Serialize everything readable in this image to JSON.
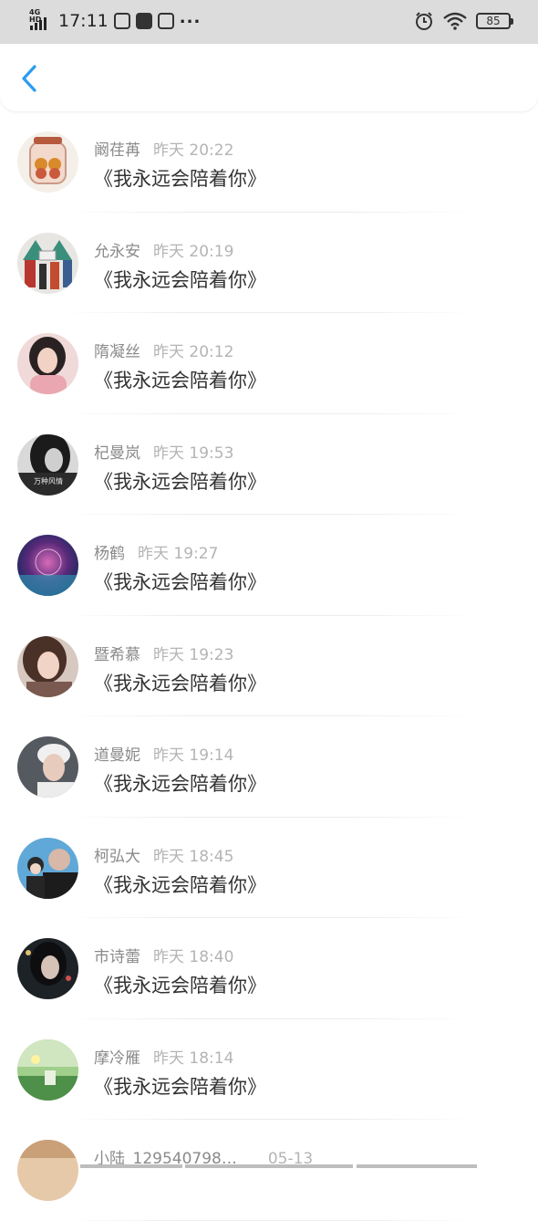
{
  "status_bar": {
    "network": "4G HD",
    "time": "17:11",
    "battery": "85",
    "icons": [
      "signal-icon",
      "qq-icon",
      "mail-icon",
      "camera-off-icon",
      "more-dots-icon",
      "alarm-icon",
      "wifi-icon",
      "battery-icon"
    ]
  },
  "header": {
    "back_icon": "chevron-left-icon",
    "accent": "#2b9cf0"
  },
  "messages": [
    {
      "name": "阚荏苒",
      "time": "昨天 20:22",
      "text": "《我永远会陪着你》"
    },
    {
      "name": "允永安",
      "time": "昨天 20:19",
      "text": "《我永远会陪着你》"
    },
    {
      "name": "隋凝丝",
      "time": "昨天 20:12",
      "text": "《我永远会陪着你》"
    },
    {
      "name": "杞曼岚",
      "time": "昨天 19:53",
      "text": "《我永远会陪着你》"
    },
    {
      "name": "杨鹤",
      "time": "昨天 19:27",
      "text": "《我永远会陪着你》"
    },
    {
      "name": "暨希慕",
      "time": "昨天 19:23",
      "text": "《我永远会陪着你》"
    },
    {
      "name": "道曼妮",
      "time": "昨天 19:14",
      "text": "《我永远会陪着你》"
    },
    {
      "name": "柯弘大",
      "time": "昨天 18:45",
      "text": "《我永远会陪着你》"
    },
    {
      "name": "市诗蕾",
      "time": "昨天 18:40",
      "text": "《我永远会陪着你》"
    },
    {
      "name": "摩冷雁",
      "time": "昨天 18:14",
      "text": "《我永远会陪着你》"
    },
    {
      "name": "小陆_129540798…",
      "time": "05-13",
      "text": ""
    }
  ],
  "avatar_label_4": "万种风情"
}
